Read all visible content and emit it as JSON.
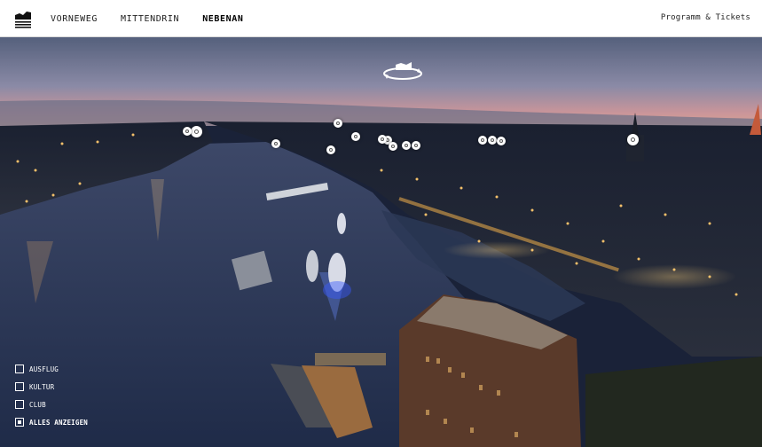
{
  "header": {
    "logo": "elbphilharmonie-logo-icon",
    "nav": [
      {
        "label": "VORNEWEG",
        "active": false
      },
      {
        "label": "MITTENDRIN",
        "active": false
      },
      {
        "label": "NEBENAN",
        "active": true
      }
    ],
    "tickets_label": "Programm & Tickets"
  },
  "scene": {
    "rotate_icon": "rotate-view-icon",
    "marker_count": 15
  },
  "filters": [
    {
      "label": "AUSFLUG",
      "checked": false
    },
    {
      "label": "KULTUR",
      "checked": false
    },
    {
      "label": "CLUB",
      "checked": false
    },
    {
      "label": "ALLES ANZEIGEN",
      "checked": true
    }
  ],
  "colors": {
    "sky_top": "#4a5570",
    "sky_horizon": "#c78a8f",
    "water": "#24324f",
    "city_lights": "#f2b04a"
  }
}
